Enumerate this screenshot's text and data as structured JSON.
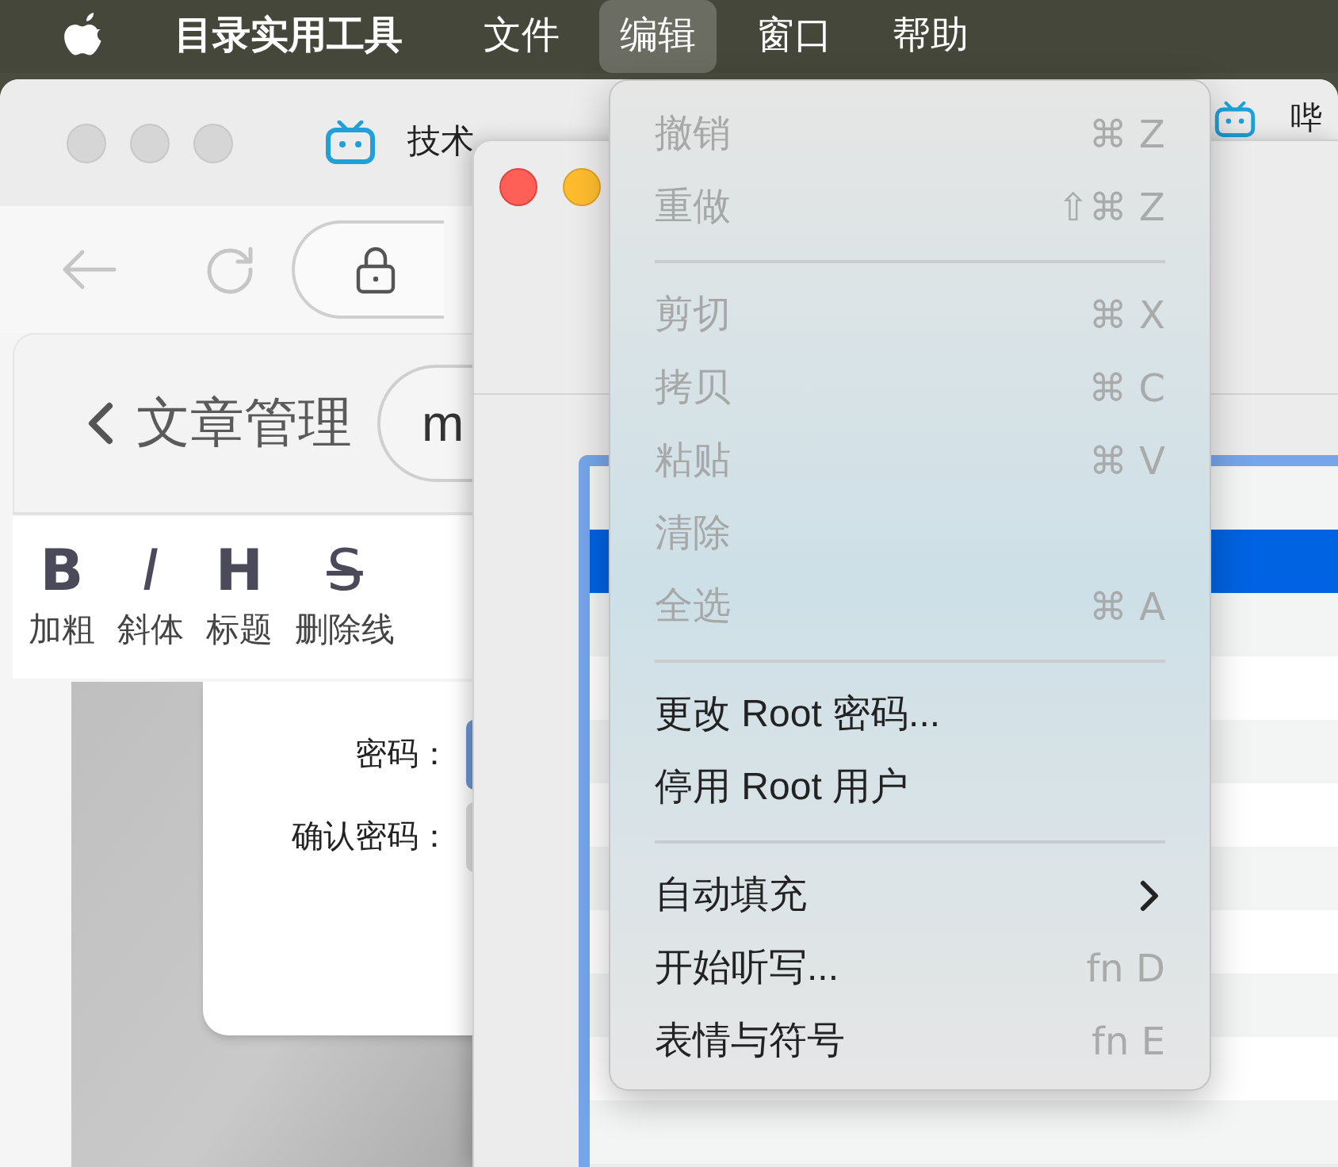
{
  "menu_bar": {
    "items": [
      {
        "label": "目录实用工具",
        "kind": "app",
        "selected": false
      },
      {
        "label": "文件",
        "kind": "menu",
        "selected": false
      },
      {
        "label": "编辑",
        "kind": "menu",
        "selected": true
      },
      {
        "label": "窗口",
        "kind": "menu",
        "selected": false
      },
      {
        "label": "帮助",
        "kind": "menu",
        "selected": false
      }
    ]
  },
  "browser": {
    "tabs": [
      {
        "title": "技术"
      },
      {
        "title": "哔"
      }
    ],
    "page": {
      "back_label": "文章管理",
      "pill_text": "m",
      "tools": [
        {
          "glyph": "B",
          "label": "加粗"
        },
        {
          "glyph": "I",
          "label": "斜体"
        },
        {
          "glyph": "H",
          "label": "标题"
        },
        {
          "glyph": "S",
          "label": "删除线"
        }
      ],
      "dialog": {
        "fields": [
          {
            "label": "密码：",
            "focused": true
          },
          {
            "label": "确认密码：",
            "focused": false
          }
        ]
      }
    }
  },
  "front_window": {
    "table_rows": [
      {
        "selected": false
      },
      {
        "selected": true
      },
      {
        "selected": false
      },
      {
        "selected": false
      },
      {
        "selected": false
      },
      {
        "selected": false
      },
      {
        "selected": false
      },
      {
        "selected": false
      },
      {
        "selected": false
      },
      {
        "selected": false
      },
      {
        "selected": false
      }
    ]
  },
  "edit_menu": {
    "items": [
      {
        "kind": "item",
        "label": "撤销",
        "shortcut": "⌘ Z",
        "disabled": true
      },
      {
        "kind": "item",
        "label": "重做",
        "shortcut": "⇧⌘ Z",
        "disabled": true
      },
      {
        "kind": "separator"
      },
      {
        "kind": "item",
        "label": "剪切",
        "shortcut": "⌘ X",
        "disabled": true
      },
      {
        "kind": "item",
        "label": "拷贝",
        "shortcut": "⌘ C",
        "disabled": true
      },
      {
        "kind": "item",
        "label": "粘贴",
        "shortcut": "⌘ V",
        "disabled": true
      },
      {
        "kind": "item",
        "label": "清除",
        "disabled": true
      },
      {
        "kind": "item",
        "label": "全选",
        "shortcut": "⌘ A",
        "disabled": true
      },
      {
        "kind": "separator"
      },
      {
        "kind": "item",
        "label": "更改 Root 密码...",
        "disabled": false
      },
      {
        "kind": "item",
        "label": "停用 Root 用户",
        "disabled": false
      },
      {
        "kind": "separator"
      },
      {
        "kind": "submenu",
        "label": "自动填充",
        "disabled": false
      },
      {
        "kind": "item",
        "label": "开始听写...",
        "shortcut": "fn D",
        "disabled": false
      },
      {
        "kind": "item",
        "label": "表情与符号",
        "shortcut": "fn E",
        "disabled": false
      }
    ]
  }
}
